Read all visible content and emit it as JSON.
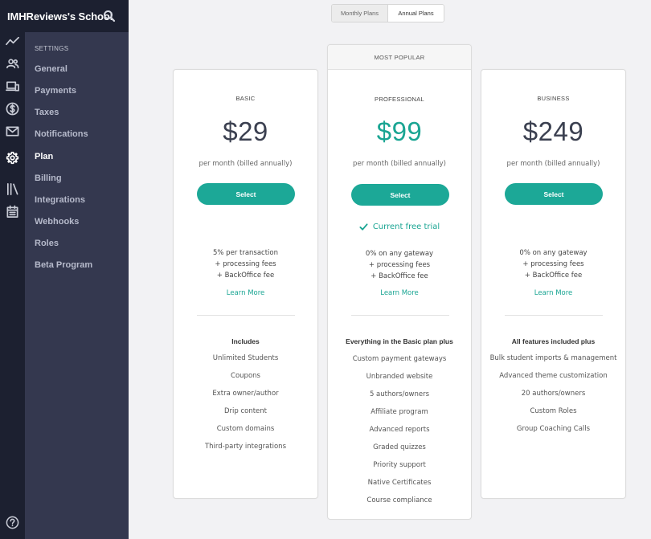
{
  "header": {
    "school_name": "IMHReviews's School",
    "search_icon": "search-icon"
  },
  "rail": {
    "icons": [
      "activity-icon",
      "users-icon",
      "devices-icon",
      "dollar-icon",
      "mail-icon",
      "gear-icon",
      "library-icon",
      "calendar-icon"
    ],
    "help_icon": "help-icon"
  },
  "sidebar": {
    "section_label": "SETTINGS",
    "items": [
      {
        "label": "General",
        "active": false
      },
      {
        "label": "Payments",
        "active": false
      },
      {
        "label": "Taxes",
        "active": false
      },
      {
        "label": "Notifications",
        "active": false
      },
      {
        "label": "Plan",
        "active": true
      },
      {
        "label": "Billing",
        "active": false
      },
      {
        "label": "Integrations",
        "active": false
      },
      {
        "label": "Webhooks",
        "active": false
      },
      {
        "label": "Roles",
        "active": false
      },
      {
        "label": "Beta Program",
        "active": false
      }
    ]
  },
  "toggle": {
    "monthly": "Monthly Plans",
    "annual": "Annual Plans",
    "selected": "Annual Plans"
  },
  "colors": {
    "accent": "#1ca897",
    "sidebar": "#34384f",
    "rail": "#1c2030"
  },
  "plans": {
    "basic": {
      "name": "BASIC",
      "price": "$29",
      "period": "per month (billed annually)",
      "select": "Select",
      "fee_main": "5% per transaction",
      "fee_line2": "+ processing fees",
      "fee_line3": "+ BackOffice fee",
      "learn_more": "Learn More",
      "includes": "Includes",
      "features": [
        "Unlimited Students",
        "Coupons",
        "Extra owner/author",
        "Drip content",
        "Custom domains",
        "Third-party integrations"
      ]
    },
    "professional": {
      "banner": "MOST POPULAR",
      "name": "PROFESSIONAL",
      "price": "$99",
      "period": "per month (billed annually)",
      "select": "Select",
      "trial": "Current free trial",
      "fee_main": "0% on any gateway",
      "fee_line2": "+ processing fees",
      "fee_line3": "+ BackOffice fee",
      "learn_more": "Learn More",
      "includes": "Everything in the Basic plan plus",
      "features": [
        "Custom payment gateways",
        "Unbranded website",
        "5 authors/owners",
        "Affiliate program",
        "Advanced reports",
        "Graded quizzes",
        "Priority support",
        "Native Certificates",
        "Course compliance"
      ]
    },
    "business": {
      "name": "BUSINESS",
      "price": "$249",
      "period": "per month (billed annually)",
      "select": "Select",
      "fee_main": "0% on any gateway",
      "fee_line2": "+ processing fees",
      "fee_line3": "+ BackOffice fee",
      "learn_more": "Learn More",
      "includes": "All features included plus",
      "features": [
        "Bulk student imports & management",
        "Advanced theme customization",
        "20 authors/owners",
        "Custom Roles",
        "Group Coaching Calls"
      ]
    }
  }
}
